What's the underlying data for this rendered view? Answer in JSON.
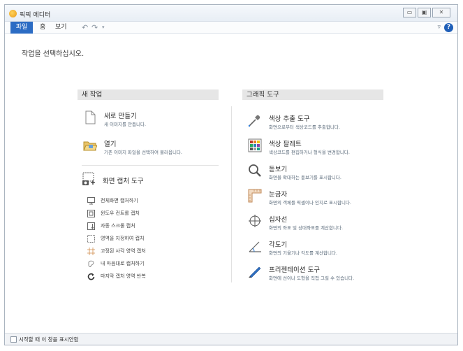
{
  "window": {
    "title": "픽픽 에디터"
  },
  "ribbon": {
    "tabs": {
      "file": "파일",
      "home": "홈",
      "view": "보기"
    },
    "undo_icon": "undo-icon",
    "redo_icon": "redo-icon",
    "qa_dropdown": "▾",
    "collapse_icon": "▿",
    "help": "?"
  },
  "main": {
    "prompt": "작업을 선택하십시오."
  },
  "new_work": {
    "header": "새 작업",
    "new_image": {
      "title": "새로 만들기",
      "desc": "새 이미지를 만듭니다."
    },
    "open": {
      "title": "열기",
      "desc": "기존 이미지 파일을 선택하여 불러옵니다."
    },
    "capture": {
      "title": "화면 캡처 도구",
      "items": [
        {
          "label": "전체화면 캡처하기",
          "icon": "monitor-icon"
        },
        {
          "label": "윈도우 컨트롤 캡처",
          "icon": "window-control-icon"
        },
        {
          "label": "자동 스크롤 캡처",
          "icon": "scroll-capture-icon"
        },
        {
          "label": "영역을 지정하여 캡처",
          "icon": "region-icon"
        },
        {
          "label": "고정된 사각 영역 캡처",
          "icon": "fixed-region-icon"
        },
        {
          "label": "내 마음대로 캡처하기",
          "icon": "freehand-icon"
        },
        {
          "label": "마지막 캡처 영역 반복",
          "icon": "repeat-icon"
        }
      ]
    }
  },
  "graphic_tools": {
    "header": "그래픽 도구",
    "items": [
      {
        "title": "색상 추출 도구",
        "desc": "화면으로부터 색상코드를 추출합니다.",
        "icon": "eyedropper-icon"
      },
      {
        "title": "색상 팔레트",
        "desc": "색상코드를 편집하거나 형식을 변경합니다.",
        "icon": "palette-icon"
      },
      {
        "title": "돋보기",
        "desc": "화면을 확대하는 돋보기를 표시합니다.",
        "icon": "magnifier-icon"
      },
      {
        "title": "눈금자",
        "desc": "화면의 객체를 픽셀이나 인치로 표시합니다.",
        "icon": "ruler-icon"
      },
      {
        "title": "십자선",
        "desc": "화면의 좌표 및 상대좌표를 계산합니다.",
        "icon": "crosshair-icon"
      },
      {
        "title": "각도기",
        "desc": "화면의 기울기나 각도를 계산합니다.",
        "icon": "protractor-icon"
      },
      {
        "title": "프리젠테이션 도구",
        "desc": "화면에 선이나 도형을 직접 그릴 수 있습니다.",
        "icon": "pen-icon"
      }
    ]
  },
  "footer": {
    "checkbox_label": "시작할 때 이 창을 표시안함",
    "checked": false
  }
}
